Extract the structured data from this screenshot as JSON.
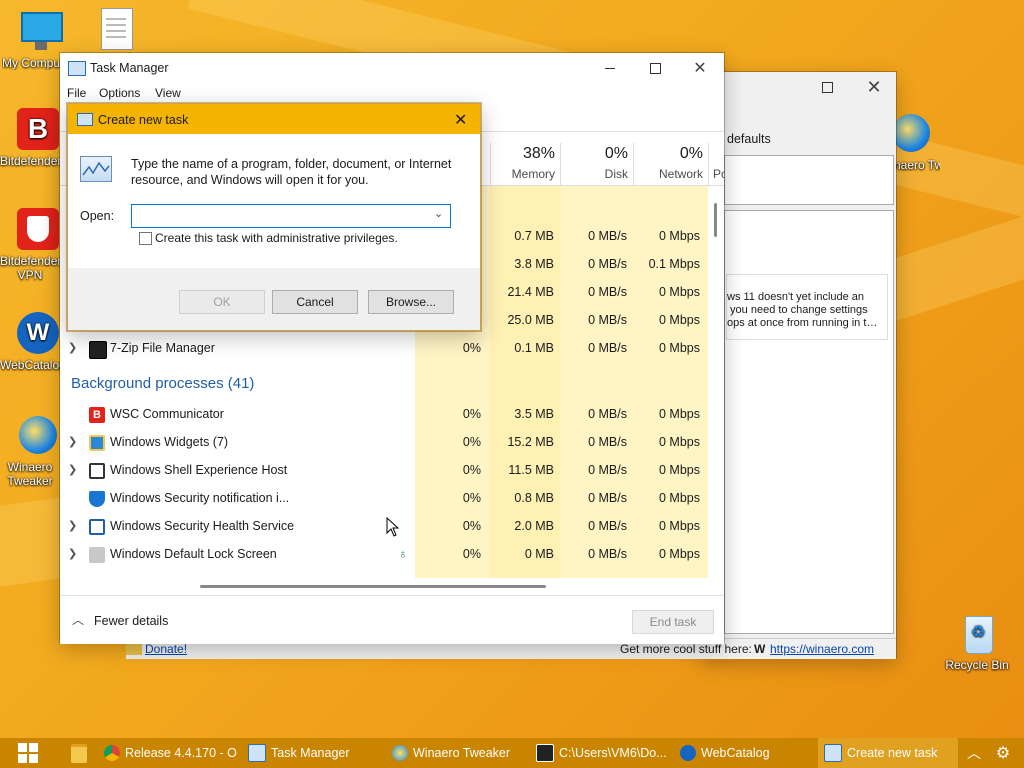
{
  "desktop": {
    "icons": [
      {
        "label": "My Computer"
      },
      {
        "label": "Bitdefender"
      },
      {
        "label": "Bitdefender VPN"
      },
      {
        "label": "WebCatalog"
      },
      {
        "label": "Winaero Tweaker"
      },
      {
        "label": "Winaero Tw..."
      },
      {
        "label": "Recycle Bin"
      }
    ]
  },
  "back_window": {
    "tab_label": "defaults",
    "message": "ws 11 doesn't yet include an\n you need to change settings\nops at once from running in t…",
    "footer_link": "Donate!",
    "footer_text": "Get more cool stuff here:",
    "footer_url": "https://winaero.com"
  },
  "task_manager": {
    "title": "Task Manager",
    "menu": [
      "File",
      "Options",
      "View"
    ],
    "columns": [
      {
        "pct": "38%",
        "name": "Memory"
      },
      {
        "pct": "0%",
        "name": "Disk"
      },
      {
        "pct": "0%",
        "name": "Network"
      },
      {
        "pct": "",
        "name": "Po"
      }
    ],
    "top_rows": [
      {
        "memory": "0.7 MB",
        "disk": "0 MB/s",
        "network": "0 Mbps"
      },
      {
        "memory": "3.8 MB",
        "disk": "0 MB/s",
        "network": "0.1 Mbps"
      },
      {
        "memory": "21.4 MB",
        "disk": "0 MB/s",
        "network": "0 Mbps"
      },
      {
        "memory": "25.0 MB",
        "disk": "0 MB/s",
        "network": "0 Mbps"
      }
    ],
    "app_rows": [
      {
        "name": "7-Zip File Manager",
        "cpu": "0%",
        "memory": "0.1 MB",
        "disk": "0 MB/s",
        "network": "0 Mbps"
      }
    ],
    "background_header": "Background processes (41)",
    "background_rows": [
      {
        "name": "WSC Communicator",
        "cpu": "0%",
        "memory": "3.5 MB",
        "disk": "0 MB/s",
        "network": "0 Mbps"
      },
      {
        "name": "Windows Widgets (7)",
        "cpu": "0%",
        "memory": "15.2 MB",
        "disk": "0 MB/s",
        "network": "0 Mbps"
      },
      {
        "name": "Windows Shell Experience Host",
        "cpu": "0%",
        "memory": "11.5 MB",
        "disk": "0 MB/s",
        "network": "0 Mbps"
      },
      {
        "name": "Windows Security notification i...",
        "cpu": "0%",
        "memory": "0.8 MB",
        "disk": "0 MB/s",
        "network": "0 Mbps"
      },
      {
        "name": "Windows Security Health Service",
        "cpu": "0%",
        "memory": "2.0 MB",
        "disk": "0 MB/s",
        "network": "0 Mbps"
      },
      {
        "name": "Windows Default Lock Screen",
        "cpu": "0%",
        "memory": "0 MB",
        "disk": "0 MB/s",
        "network": "0 Mbps"
      }
    ],
    "fewer_details": "Fewer details",
    "end_task": "End task"
  },
  "dialog": {
    "title": "Create new task",
    "description": "Type the name of a program, folder, document, or Internet resource, and Windows will open it for you.",
    "open_label": "Open:",
    "open_value": "",
    "admin_checkbox": "Create this task with administrative privileges.",
    "ok": "OK",
    "cancel": "Cancel",
    "browse": "Browse..."
  },
  "taskbar": {
    "items": [
      {
        "label": "Release 4.4.170 - O..."
      },
      {
        "label": "Task Manager"
      },
      {
        "label": "Winaero Tweaker"
      },
      {
        "label": "C:\\Users\\VM6\\Do..."
      },
      {
        "label": "WebCatalog"
      },
      {
        "label": "Create new task"
      }
    ],
    "colors": {
      "bar": "#c98400",
      "active": "#e0a020"
    }
  }
}
